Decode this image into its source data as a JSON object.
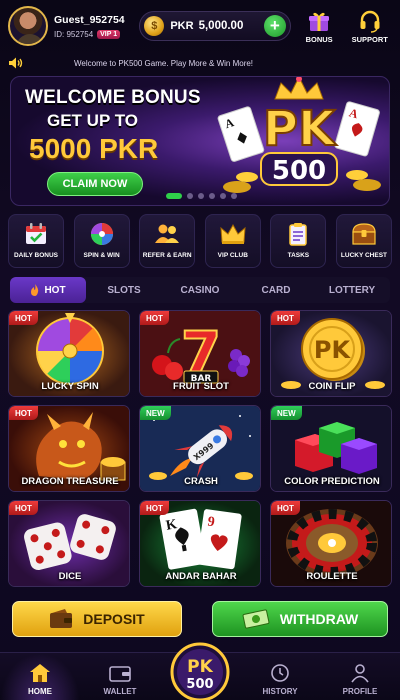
{
  "header": {
    "username": "Guest_952754",
    "user_id": "ID: 952754",
    "vip": "VIP 1",
    "currency": "PKR",
    "balance": "5,000.00",
    "coin_symbol": "$",
    "plus_symbol": "+",
    "bonus_label": "BONUS",
    "support_label": "SUPPORT"
  },
  "marquee": {
    "text": "Welcome to PK500 Game. Play More & Win More!"
  },
  "banner": {
    "line1": "WELCOME BONUS",
    "line2": "GET UP TO",
    "line3": "5000 PKR",
    "cta": "CLAIM NOW",
    "logo_top": "PK",
    "logo_bottom": "500",
    "slide_count": 6,
    "active_slide": 1
  },
  "quick_menu": [
    {
      "label": "DAILY BONUS",
      "icon": "calendar-check-icon"
    },
    {
      "label": "SPIN & WIN",
      "icon": "wheel-icon"
    },
    {
      "label": "REFER & EARN",
      "icon": "users-icon"
    },
    {
      "label": "VIP CLUB",
      "icon": "crown-icon"
    },
    {
      "label": "TASKS",
      "icon": "clipboard-icon"
    },
    {
      "label": "LUCKY CHEST",
      "icon": "chest-icon"
    }
  ],
  "tabs": [
    {
      "label": "HOT",
      "icon": "fire-icon",
      "active": true
    },
    {
      "label": "SLOTS"
    },
    {
      "label": "CASINO"
    },
    {
      "label": "CARD"
    },
    {
      "label": "LOTTERY"
    }
  ],
  "games": [
    {
      "title": "LUCKY SPIN",
      "badge": "HOT",
      "art": "wheel"
    },
    {
      "title": "FRUIT SLOT",
      "badge": "HOT",
      "art": "slot",
      "art_text": "BAR"
    },
    {
      "title": "COIN FLIP",
      "badge": "HOT",
      "art": "coin",
      "art_text": "PK"
    },
    {
      "title": "DRAGON TREASURE",
      "badge": "HOT",
      "art": "dragon"
    },
    {
      "title": "CRASH",
      "badge": "NEW",
      "art": "rocket",
      "art_text": "X999"
    },
    {
      "title": "COLOR PREDICTION",
      "badge": "NEW",
      "art": "cubes"
    },
    {
      "title": "DICE",
      "badge": "HOT",
      "art": "dice"
    },
    {
      "title": "ANDAR BAHAR",
      "badge": "HOT",
      "art": "cards",
      "art_text": "K",
      "art_text2": "9"
    },
    {
      "title": "ROULETTE",
      "badge": "HOT",
      "art": "roulette"
    }
  ],
  "actions": {
    "deposit": "DEPOSIT",
    "withdraw": "WITHDRAW"
  },
  "nav": {
    "home": "HOME",
    "wallet": "WALLET",
    "center_top": "PK",
    "center_bottom": "500",
    "history": "HISTORY",
    "profile": "PROFILE"
  },
  "colors": {
    "accent_gold": "#ffc93a",
    "accent_green": "#2fd04a",
    "accent_purple": "#6a38c8",
    "hot_red": "#ef3b3b",
    "new_green": "#2ecf5a"
  }
}
